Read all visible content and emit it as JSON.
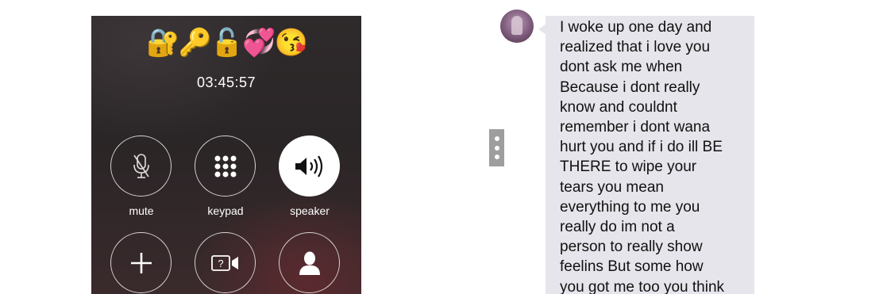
{
  "call": {
    "caller_name": "🔐🔑🔓💞😘",
    "timer": "03:45:57",
    "buttons": [
      {
        "label": "mute",
        "icon": "mute-icon"
      },
      {
        "label": "keypad",
        "icon": "keypad-icon"
      },
      {
        "label": "speaker",
        "icon": "speaker-icon",
        "active": true
      },
      {
        "label": "",
        "icon": "add-call-icon"
      },
      {
        "label": "",
        "icon": "facetime-icon"
      },
      {
        "label": "",
        "icon": "contacts-icon"
      }
    ]
  },
  "options_handle": {
    "icon": "vertical-ellipsis-icon"
  },
  "message": {
    "avatar": "contact-avatar",
    "lines": [
      "I woke up one day and",
      "realized that i love you",
      "dont ask me when",
      "Because i dont really",
      "know and couldnt",
      "remember i dont wana",
      "hurt you and if i do ill BE",
      "THERE to wipe your",
      "tears you mean",
      "everything to me you",
      "really do im not a",
      "person to really show",
      "feelins But some how",
      "you got me too you think"
    ]
  }
}
